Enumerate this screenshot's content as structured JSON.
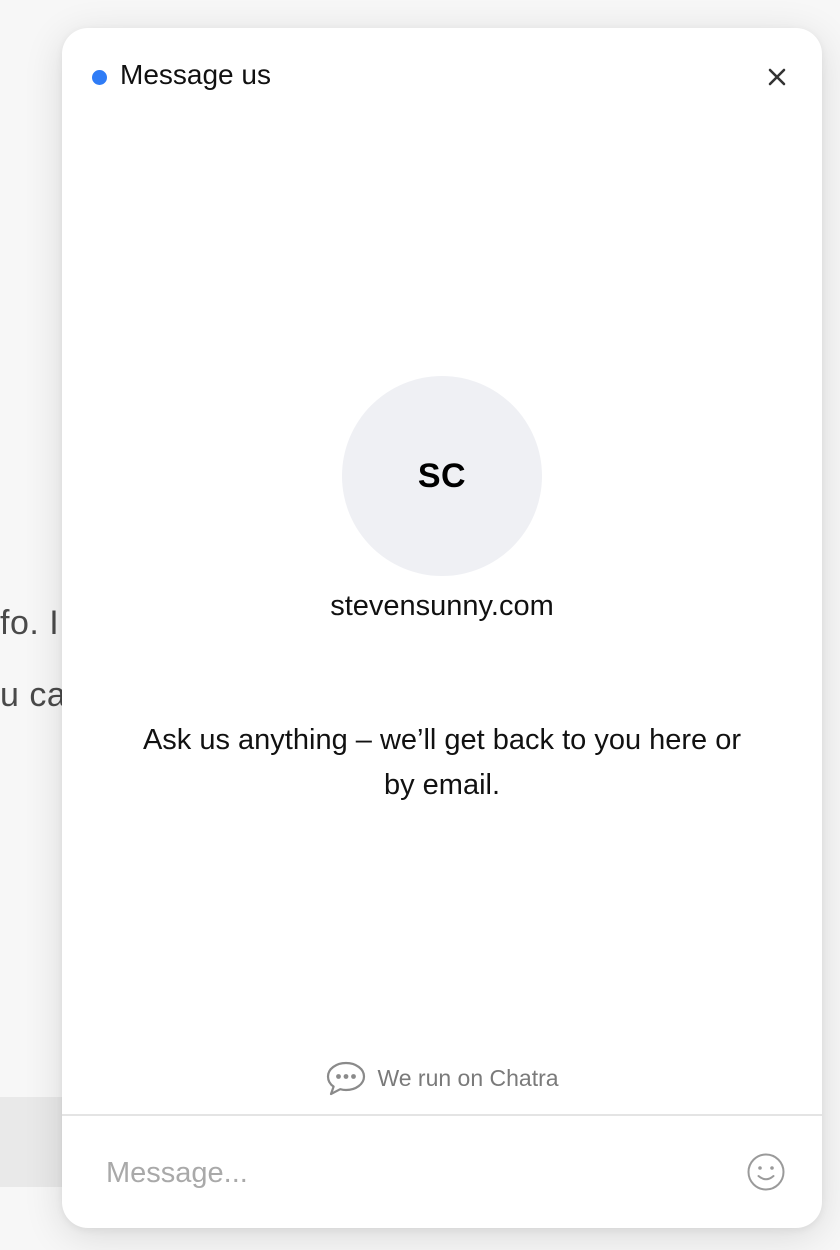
{
  "background_page": {
    "line1": "fo. I",
    "line2": "u ca"
  },
  "widget": {
    "title": "Message us",
    "status_color": "#2f7cf6",
    "close_icon": "close-icon",
    "avatar": {
      "initials": "SC",
      "background": "#eff0f4"
    },
    "site_name": "stevensunny.com",
    "welcome_message": "Ask us anything – we’ll get back to you here or by email.",
    "powered_by": {
      "icon": "chat-bubble-icon",
      "label": "We run on Chatra"
    },
    "composer": {
      "placeholder": "Message...",
      "value": "",
      "emoji_icon": "smiley-icon"
    }
  }
}
